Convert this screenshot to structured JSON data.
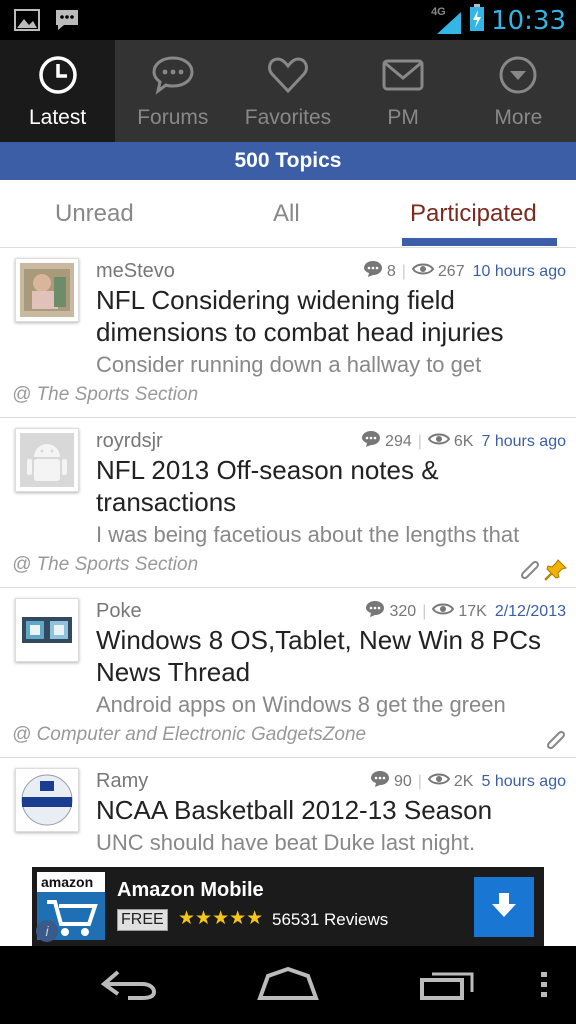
{
  "status": {
    "time": "10:33",
    "network": "4G",
    "left_icons": [
      "image-notification-icon",
      "chat-notification-icon"
    ]
  },
  "nav": {
    "items": [
      {
        "label": "Latest",
        "icon": "clock-icon",
        "active": true
      },
      {
        "label": "Forums",
        "icon": "speech-bubble-icon",
        "active": false
      },
      {
        "label": "Favorites",
        "icon": "heart-icon",
        "active": false
      },
      {
        "label": "PM",
        "icon": "envelope-icon",
        "active": false
      },
      {
        "label": "More",
        "icon": "chevron-circle-icon",
        "active": false
      }
    ]
  },
  "topics_header": "500 Topics",
  "tabs": {
    "unread": "Unread",
    "all": "All",
    "participated": "Participated",
    "active": "participated"
  },
  "posts": [
    {
      "author": "meStevo",
      "replies": "8",
      "views": "267",
      "time": "10 hours ago",
      "title": "NFL Considering widening field dimensions to combat head injuries",
      "preview": "Consider running down a hallway to get",
      "forum": "@ The Sports Section",
      "attachment": false,
      "pinned": false
    },
    {
      "author": "royrdsjr",
      "replies": "294",
      "views": "6K",
      "time": "7 hours ago",
      "title": "NFL 2013 Off-season notes & transactions",
      "preview": "I was being facetious about the lengths that",
      "forum": "@ The Sports Section",
      "attachment": true,
      "pinned": true
    },
    {
      "author": "Poke",
      "replies": "320",
      "views": "17K",
      "time": "2/12/2013",
      "title": "Windows 8 OS,Tablet, New Win 8 PCs News Thread",
      "preview": "Android apps on Windows 8 get the green",
      "forum": "@ Computer and Electronic GadgetsZone",
      "attachment": true,
      "pinned": false
    },
    {
      "author": "Ramy",
      "replies": "90",
      "views": "2K",
      "time": "5 hours ago",
      "title": "NCAA Basketball 2012-13 Season",
      "preview": "UNC should have beat Duke last night.",
      "forum": "",
      "attachment": false,
      "pinned": false
    }
  ],
  "ad": {
    "brand": "amazon",
    "title": "Amazon Mobile",
    "price": "FREE",
    "stars": "★★★★★",
    "reviews": "56531 Reviews"
  },
  "colors": {
    "accent": "#3b5ea6",
    "active_tab_text": "#7a2a1e",
    "status_clock": "#33b5e5"
  }
}
